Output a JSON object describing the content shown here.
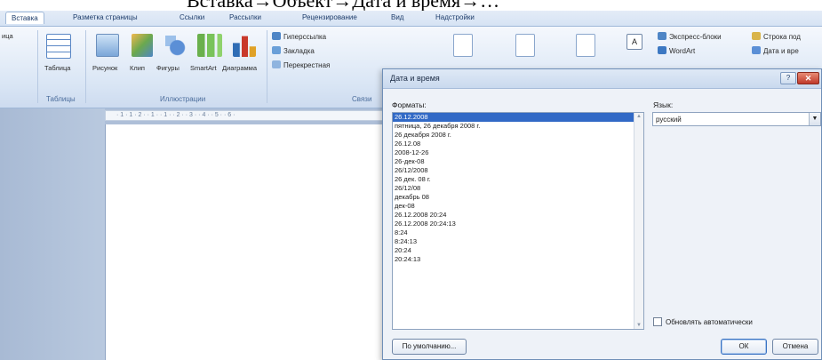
{
  "caption": "Вставка→Объект→Дата и время→…",
  "ribbon": {
    "tabs": [
      "Вставка",
      "Разметка страницы",
      "Ссылки",
      "Рассылки",
      "Рецензирование",
      "Вид",
      "Надстройки"
    ],
    "left_cut_label": "ица",
    "buttons": {
      "table": "Таблица",
      "picture": "Рисунок",
      "clip": "Клип",
      "shapes": "Фигуры",
      "smartart": "SmartArt",
      "chart": "Диаграмма"
    },
    "links_items": [
      "Гиперссылка",
      "Закладка",
      "Перекрестная"
    ],
    "right_items": [
      "Экспресс-блоки",
      "WordArt",
      "Строка под",
      "Дата и вре"
    ],
    "groups": {
      "tables": "Таблицы",
      "illustrations": "Иллюстрации",
      "links": "Связи"
    },
    "ruler_text": "· 1 · 1 · 2 · · 1 · · 1 · · 2 · · 3 · · 4 · · 5 · · 6 ·"
  },
  "dialog": {
    "title": "Дата и время",
    "formats_label": "Форматы:",
    "formats": [
      "26.12.2008",
      "пятница, 26 декабря 2008 г.",
      "26 декабря 2008 г.",
      "26.12.08",
      "2008-12-26",
      "26-дек-08",
      "26/12/2008",
      "26 дек. 08 г.",
      "26/12/08",
      "декабрь 08",
      "дек-08",
      "26.12.2008 20:24",
      "26.12.2008 20:24:13",
      "8:24",
      "8:24:13",
      "20:24",
      "20:24:13"
    ],
    "selected_index": 0,
    "language_label": "Язык:",
    "language_value": "русский",
    "auto_update_label": "Обновлять автоматически",
    "auto_update_checked": false,
    "default_button": "По умолчанию...",
    "ok_button": "ОК",
    "cancel_button": "Отмена",
    "help_glyph": "?",
    "close_glyph": "✕"
  }
}
